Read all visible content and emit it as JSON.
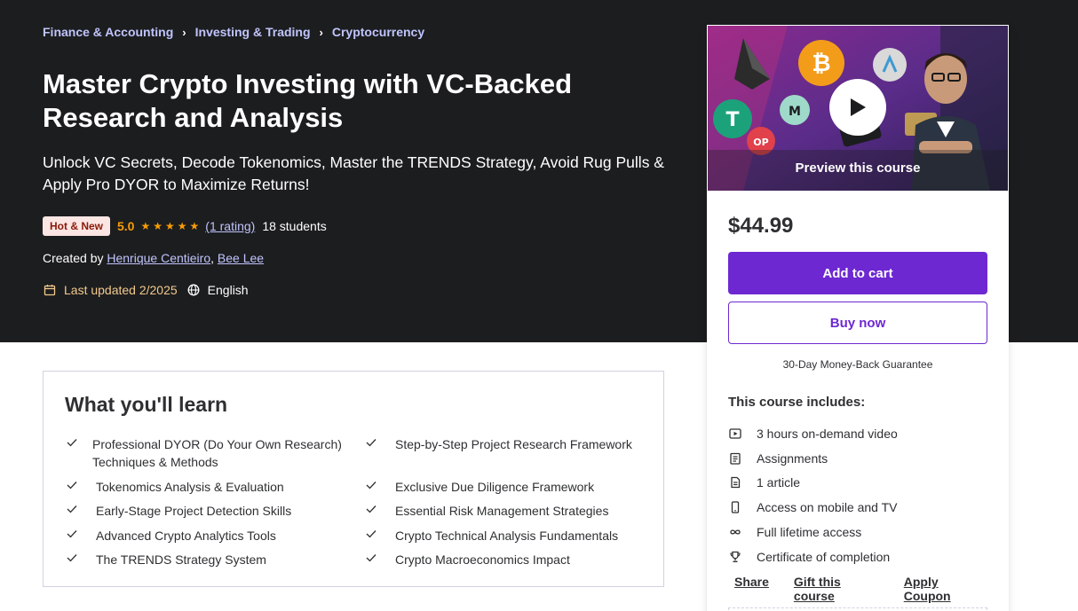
{
  "breadcrumb": [
    "Finance & Accounting",
    "Investing & Trading",
    "Cryptocurrency"
  ],
  "course": {
    "title": "Master Crypto Investing with VC-Backed Research and Analysis",
    "subtitle": "Unlock VC Secrets, Decode Tokenomics, Master the TRENDS Strategy, Avoid Rug Pulls & Apply Pro DYOR to Maximize Returns!",
    "badge": "Hot & New",
    "rating": "5.0",
    "stars": 5,
    "rating_count": "(1 rating)",
    "students": "18 students",
    "created_by_label": "Created by",
    "authors": [
      "Henrique Centieiro",
      "Bee Lee"
    ],
    "last_updated": "Last updated 2/2025",
    "language": "English"
  },
  "card": {
    "preview_label": "Preview this course",
    "price": "$44.99",
    "add_to_cart": "Add to cart",
    "buy_now": "Buy now",
    "guarantee": "30-Day Money-Back Guarantee",
    "includes_title": "This course includes:",
    "includes": [
      {
        "icon": "video-icon",
        "text": "3 hours on-demand video"
      },
      {
        "icon": "assignment-icon",
        "text": "Assignments"
      },
      {
        "icon": "article-icon",
        "text": "1 article"
      },
      {
        "icon": "mobile-icon",
        "text": "Access on mobile and TV"
      },
      {
        "icon": "infinity-icon",
        "text": "Full lifetime access"
      },
      {
        "icon": "trophy-icon",
        "text": "Certificate of completion"
      }
    ],
    "links": {
      "share": "Share",
      "gift": "Gift this course",
      "coupon": "Apply Coupon"
    }
  },
  "learn": {
    "title": "What you'll learn",
    "left": [
      "Professional DYOR (Do Your Own Research) Techniques & Methods",
      "Tokenomics Analysis & Evaluation",
      "Early-Stage Project Detection Skills",
      "Advanced Crypto Analytics Tools",
      "The TRENDS Strategy System"
    ],
    "right": [
      "Step-by-Step Project Research Framework",
      "Exclusive Due Diligence Framework",
      "Essential Risk Management Strategies",
      "Crypto Technical Analysis Fundamentals",
      "Crypto Macroeconomics Impact"
    ]
  },
  "colors": {
    "hero_bg": "#1c1d1f",
    "link_purple": "#c0c4fc",
    "accent": "#6d28d2",
    "star": "#f69c08",
    "badge_bg": "#fbe6e4"
  }
}
